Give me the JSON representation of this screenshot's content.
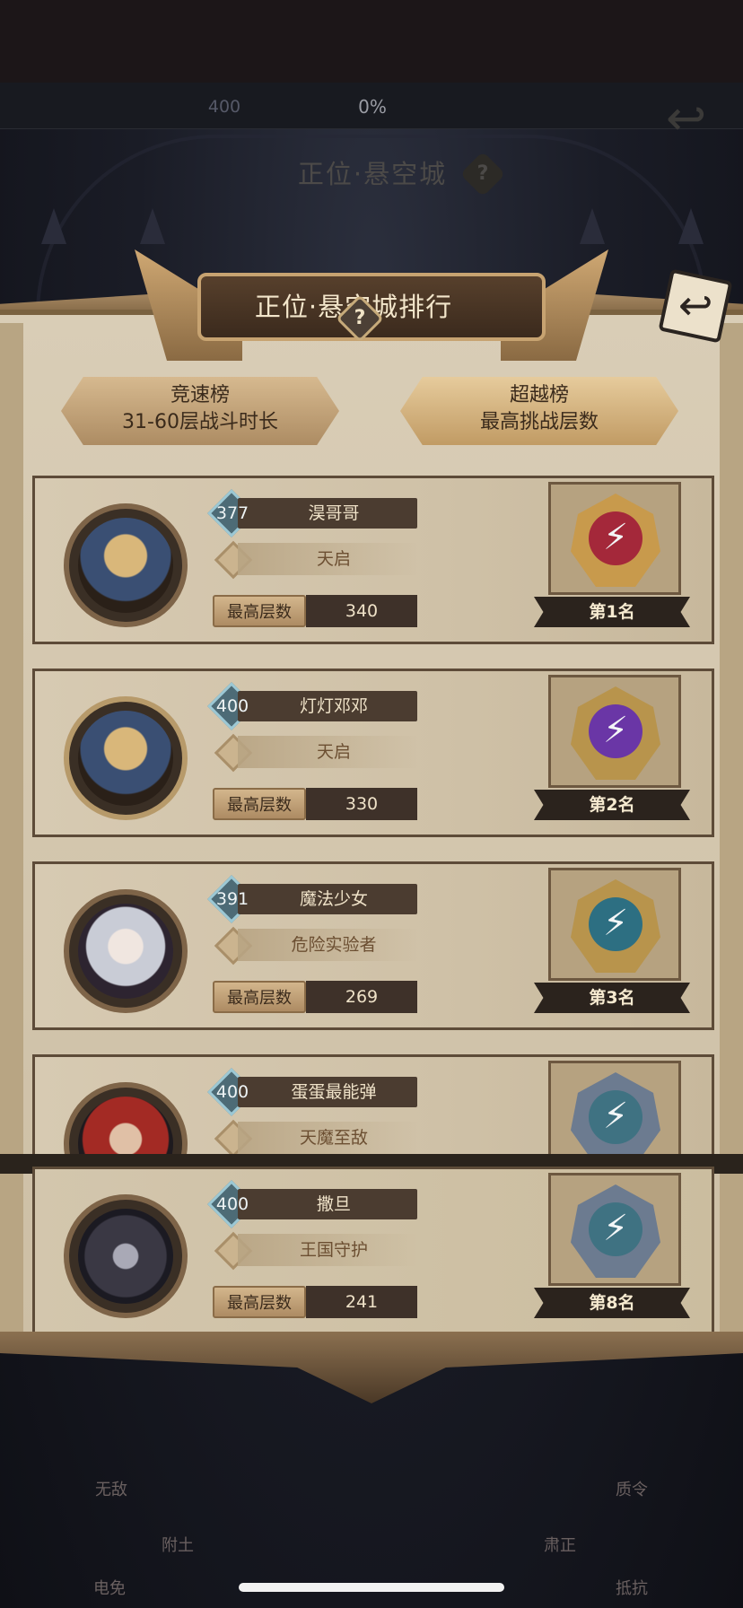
{
  "background": {
    "level_badge": "400",
    "progress_percent": "0%",
    "title": "正位·悬空城",
    "help": "?"
  },
  "header": {
    "title": "正位·悬空城排行",
    "help": "?",
    "back_icon": "back-arrow-icon"
  },
  "tabs": [
    {
      "title": "竞速榜",
      "subtitle": "31-60层战斗时长",
      "active": false
    },
    {
      "title": "超越榜",
      "subtitle": "最高挑战层数",
      "active": true
    }
  ],
  "floor_label": "最高层数",
  "entries": [
    {
      "level": "377",
      "name": "淏哥哥",
      "title": "天启",
      "floors": "340",
      "rank": "第1名",
      "gem_color": "#a4283a",
      "gem_rim": "#c89a4c"
    },
    {
      "level": "400",
      "name": "灯灯邓邓",
      "title": "天启",
      "floors": "330",
      "rank": "第2名",
      "gem_color": "#6a36a6",
      "gem_rim": "#b8944c"
    },
    {
      "level": "391",
      "name": "魔法少女",
      "title": "危险实验者",
      "floors": "269",
      "rank": "第3名",
      "gem_color": "#2d6f82",
      "gem_rim": "#b8944c"
    },
    {
      "level": "400",
      "name": "蛋蛋最能弹",
      "title": "天魔至敌",
      "floors": "",
      "rank": "",
      "gem_color": "#3f7282",
      "gem_rim": "#6c7b90"
    }
  ],
  "my_entry": {
    "level": "400",
    "name": "撒旦",
    "title": "王国守护",
    "floors": "241",
    "rank": "第8名",
    "gem_color": "#3f7282",
    "gem_rim": "#6c7b90"
  },
  "skills": [
    "无敌",
    "附土",
    "肃正",
    "质令",
    "电免",
    "抵抗"
  ]
}
